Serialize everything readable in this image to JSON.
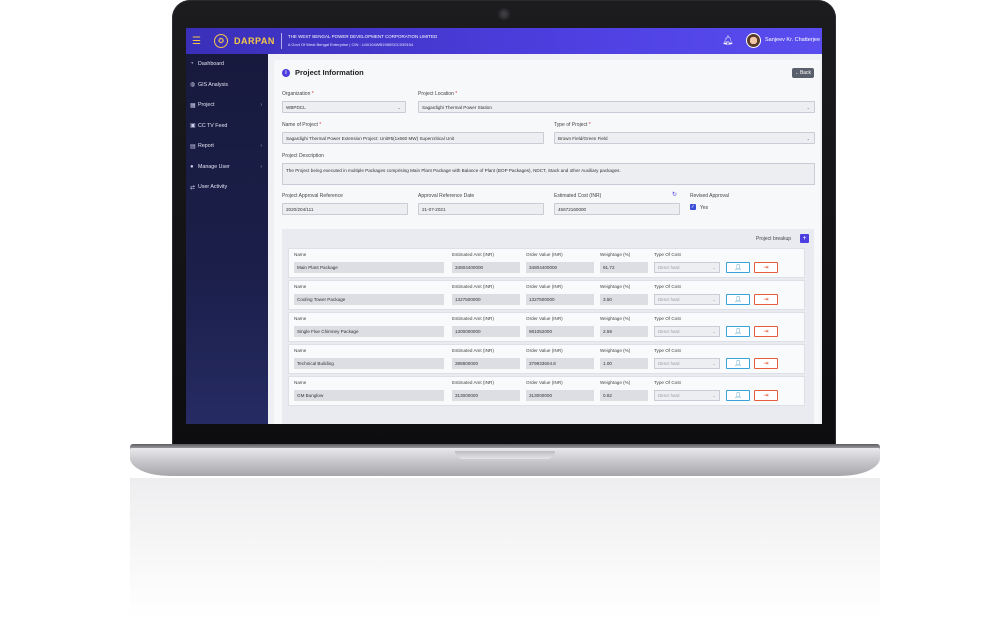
{
  "header": {
    "brand": "DARPAN",
    "org_name": "THE WEST BENGAL POWER DEVELOPMENT CORPORATION LIMITED",
    "org_sub": "A Govt Of West Bengal Enterprise | CIN : U40104WB1985SGC039154",
    "user_name": "Sanjeev Kr. Chatterjee",
    "icons": {
      "menu": "hamburger-icon",
      "bell": "bell-icon"
    }
  },
  "sidebar": {
    "items": [
      {
        "label": "Dashboard",
        "icon": "dashboard-icon",
        "chevron": ""
      },
      {
        "label": "GIS Analysis",
        "icon": "globe-icon",
        "chevron": ""
      },
      {
        "label": "Project",
        "icon": "grid-icon",
        "chevron": "›"
      },
      {
        "label": "CC TV Feed",
        "icon": "camera-icon",
        "chevron": ""
      },
      {
        "label": "Report",
        "icon": "report-icon",
        "chevron": "›"
      },
      {
        "label": "Manage User",
        "icon": "user-icon",
        "chevron": "›"
      },
      {
        "label": "User Activity",
        "icon": "activity-icon",
        "chevron": ""
      }
    ]
  },
  "page": {
    "title": "Project Information",
    "back_label": "Back"
  },
  "form": {
    "organization": {
      "label": "Organization",
      "value": "WBPDCL"
    },
    "location": {
      "label": "Project Location",
      "value": "Sagardighi Thermal Power Station"
    },
    "name": {
      "label": "Name of Project",
      "value": "Sagardighi Thermal Power Extension Project: Unit#5(1x660 MW) Supercritical Unit"
    },
    "type": {
      "label": "Type of Project",
      "value": "Brown Field/Green Field"
    },
    "description": {
      "label": "Project Description",
      "value": "The Project being executed in multiple Packages comprising Main Plant Package with Balance of Plant (BOP Packages), NDCT, Stack and other Auxiliary packages."
    },
    "approval_ref": {
      "label": "Project Approval Reference",
      "value": "2020/204/111"
    },
    "approval_date": {
      "label": "Approval Reference Date",
      "value": "21-07-2021"
    },
    "estimated_cost": {
      "label": "Estimated Cost (INR)",
      "value": "45672160000"
    },
    "revised": {
      "label": "Revised Approval",
      "option": "Yes",
      "checked": true
    }
  },
  "breakup": {
    "title": "Project breakup",
    "col_labels": {
      "name": "Name",
      "estimated": "Estimated Amt (INR)",
      "order": "Order Value (INR)",
      "weightage": "Weightage (%)",
      "type": "Type Of Cost"
    },
    "type_placeholder": "Direct hard",
    "rows": [
      {
        "name": "Main Plant Package",
        "estimated": "34804400000",
        "order": "34804400000",
        "weightage": "91.72"
      },
      {
        "name": "Cooling Tower Package",
        "estimated": "1327500000",
        "order": "1327500000",
        "weightage": "3.50"
      },
      {
        "name": "Single Flue Chimney Package",
        "estimated": "1300000000",
        "order": "981052000",
        "weightage": "2.59"
      },
      {
        "name": "Technical Building",
        "estimated": "398800000",
        "order": "379933604.8",
        "weightage": "1.00"
      },
      {
        "name": "GM Bunglow",
        "estimated": "313000000",
        "order": "313000000",
        "weightage": "0.82"
      }
    ]
  }
}
